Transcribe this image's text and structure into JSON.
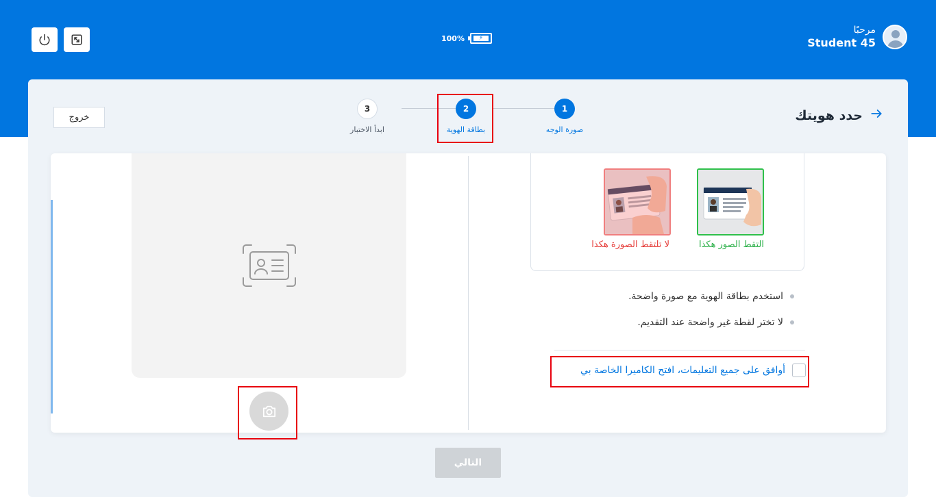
{
  "header": {
    "greeting": "مرحبًا",
    "username": "Student 45",
    "battery_percent": "100%",
    "battery_level": 100,
    "buttons": {
      "power_icon": "power-icon",
      "expand_icon": "expand-icon"
    }
  },
  "page": {
    "title": "حدد هويتك",
    "back_icon": "arrow-right-icon",
    "exit_label": "خروج"
  },
  "stepper": {
    "steps": [
      {
        "number": "1",
        "label": "صورة الوجه",
        "state": "done"
      },
      {
        "number": "2",
        "label": "بطاقة الهوية",
        "state": "current"
      },
      {
        "number": "3",
        "label": "ابدأ الاختبار",
        "state": "pending"
      }
    ]
  },
  "examples": {
    "good_label": "التقط الصور هكذا",
    "bad_label": "لا تلتقط الصورة هكذا"
  },
  "rules": [
    "استخدم بطاقة الهوية مع صورة واضحة.",
    "لا تختر لقطة غير واضحة عند التقديم."
  ],
  "agree": {
    "label": "أوافق على جميع التعليمات، افتح الكاميرا الخاصة بي",
    "checked": false
  },
  "capture": {
    "placeholder_icon": "id-card-icon",
    "camera_icon": "camera-icon"
  },
  "next_label": "التالي",
  "colors": {
    "primary": "#0176e0",
    "success": "#2ec04a",
    "danger": "#e53935",
    "highlight": "#e8000e",
    "disabled": "#cfd3d7"
  }
}
